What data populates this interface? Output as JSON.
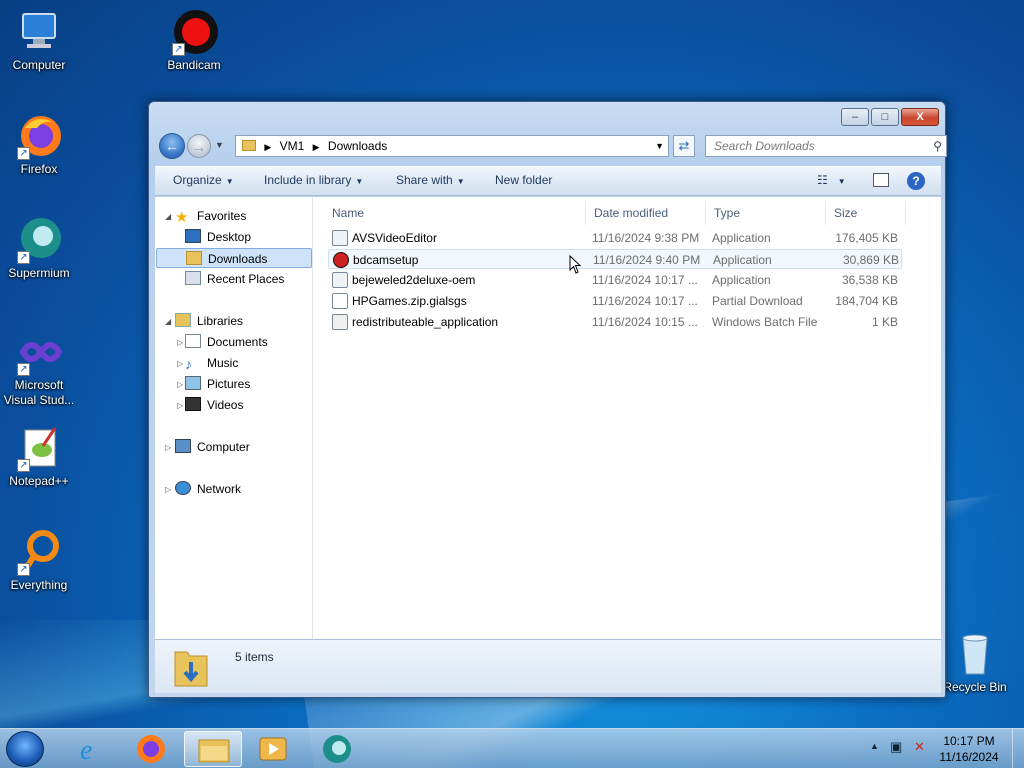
{
  "desktop": {
    "icons": [
      {
        "label": "Computer",
        "icon": "computer-icon"
      },
      {
        "label": "Bandicam",
        "icon": "bandicam-icon"
      },
      {
        "label": "Firefox",
        "icon": "firefox-icon"
      },
      {
        "label": "Supermium",
        "icon": "supermium-icon"
      },
      {
        "label": "Microsoft Visual Stud...",
        "icon": "visual-studio-icon"
      },
      {
        "label": "Notepad++",
        "icon": "notepadpp-icon"
      },
      {
        "label": "Everything",
        "icon": "everything-icon"
      },
      {
        "label": "Recycle Bin",
        "icon": "recycle-bin-icon"
      }
    ]
  },
  "window": {
    "controls": {
      "minimize": "–",
      "maximize": "□",
      "close": "X"
    },
    "address": {
      "crumbs": [
        "VM1",
        "Downloads"
      ]
    },
    "search": {
      "placeholder": "Search Downloads"
    },
    "toolbar": {
      "organize": "Organize",
      "include_in_library": "Include in library",
      "share_with": "Share with",
      "new_folder": "New folder"
    },
    "nav": {
      "favorites": "Favorites",
      "desktop": "Desktop",
      "downloads": "Downloads",
      "recent_places": "Recent Places",
      "libraries": "Libraries",
      "documents": "Documents",
      "music": "Music",
      "pictures": "Pictures",
      "videos": "Videos",
      "computer": "Computer",
      "network": "Network"
    },
    "columns": {
      "name": "Name",
      "date": "Date modified",
      "type": "Type",
      "size": "Size"
    },
    "files": [
      {
        "name": "AVSVideoEditor",
        "date": "11/16/2024 9:38 PM",
        "type": "Application",
        "size": "176,405 KB"
      },
      {
        "name": "bdcamsetup",
        "date": "11/16/2024 9:40 PM",
        "type": "Application",
        "size": "30,869 KB"
      },
      {
        "name": "bejeweled2deluxe-oem",
        "date": "11/16/2024 10:17 ...",
        "type": "Application",
        "size": "36,538 KB"
      },
      {
        "name": "HPGames.zip.gialsgs",
        "date": "11/16/2024 10:17 ...",
        "type": "Partial Download",
        "size": "184,704 KB"
      },
      {
        "name": "redistributeable_application",
        "date": "11/16/2024 10:15 ...",
        "type": "Windows Batch File",
        "size": "1 KB"
      }
    ],
    "status": {
      "items": "5 items"
    }
  },
  "taskbar": {
    "time": "10:17 PM",
    "date": "11/16/2024"
  }
}
